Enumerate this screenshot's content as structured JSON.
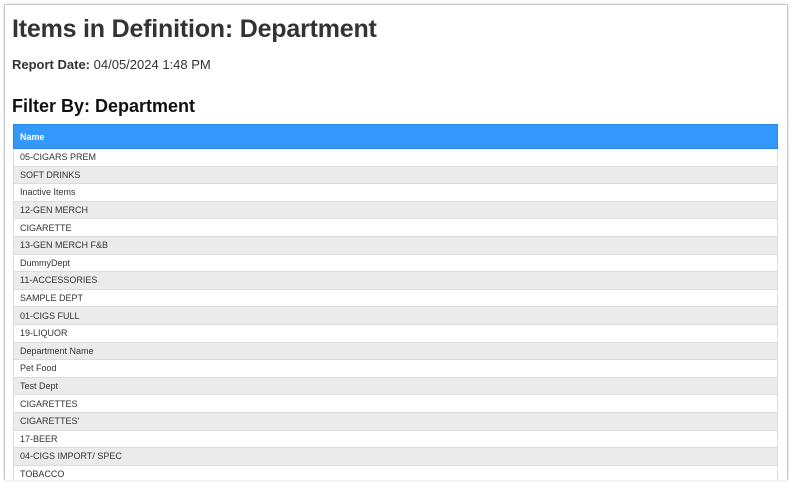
{
  "report": {
    "title": "Items in Definition: Department",
    "date_label": "Report Date:",
    "date_value": "04/05/2024 1:48 PM",
    "filter_title": "Filter By: Department"
  },
  "table": {
    "header": "Name",
    "rows": [
      "05-CIGARS PREM",
      "SOFT DRINKS",
      "Inactive Items",
      "12-GEN MERCH",
      "CIGARETTE",
      "13-GEN MERCH F&B",
      "DummyDept",
      "11-ACCESSORIES",
      "SAMPLE DEPT",
      "01-CIGS FULL",
      "19-LIQUOR",
      "Department Name",
      "Pet Food",
      "Test Dept",
      "CIGARETTES",
      "CIGARETTES'",
      "17-BEER",
      "04-CIGS IMPORT/ SPEC",
      "TOBACCO"
    ]
  },
  "colors": {
    "header_bg": "#3399ff",
    "header_text": "#ffffff",
    "row_alt": "#ebebeb"
  }
}
